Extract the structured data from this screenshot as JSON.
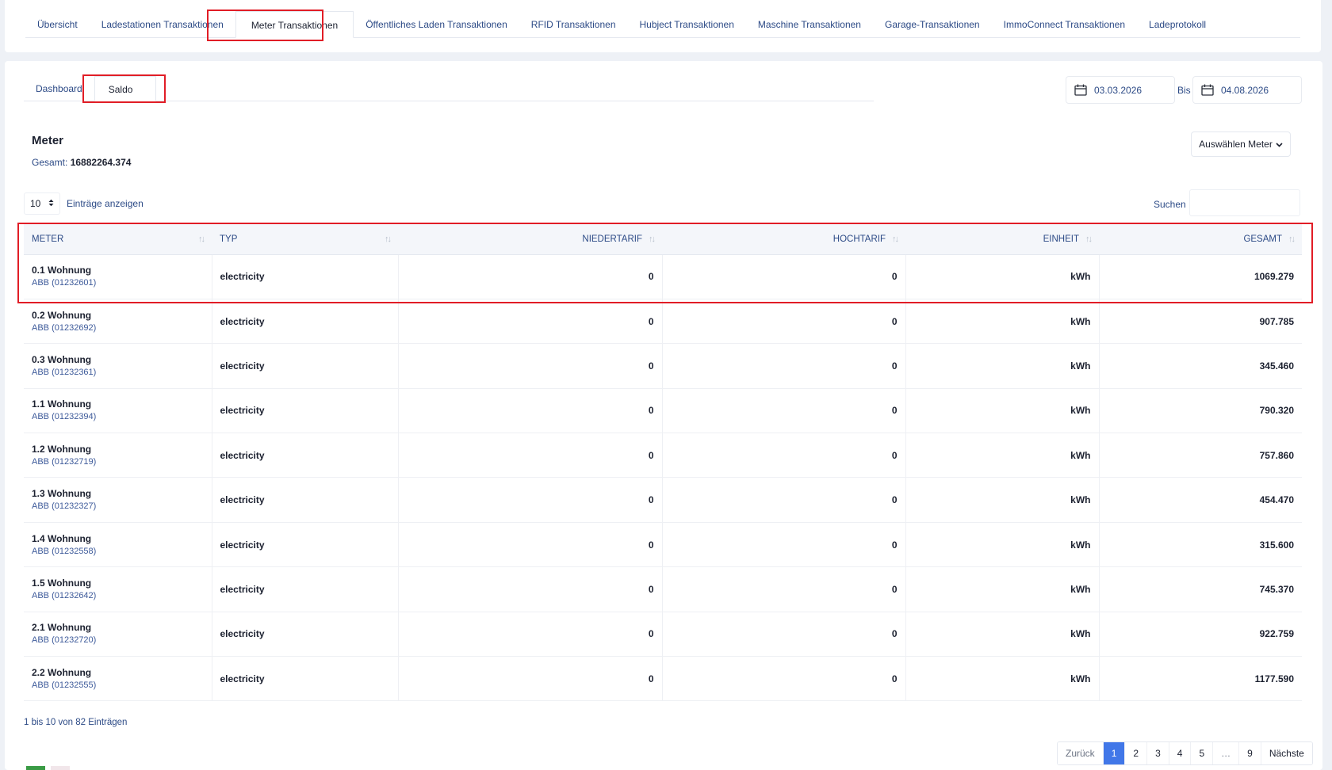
{
  "top_tabs": [
    {
      "label": "Übersicht"
    },
    {
      "label": "Ladestationen Transaktionen"
    },
    {
      "label": "Meter Transaktionen",
      "active": true
    },
    {
      "label": "Öffentliches Laden Transaktionen"
    },
    {
      "label": "RFID Transaktionen"
    },
    {
      "label": "Hubject Transaktionen"
    },
    {
      "label": "Maschine Transaktionen"
    },
    {
      "label": "Garage-Transaktionen"
    },
    {
      "label": "ImmoConnect Transaktionen"
    },
    {
      "label": "Ladeprotokoll"
    }
  ],
  "sub_tabs": [
    {
      "label": "Dashboard"
    },
    {
      "label": "Saldo",
      "active": true
    }
  ],
  "date_range": {
    "from": "03.03.2026",
    "separator": "Bis",
    "to": "04.08.2026"
  },
  "summary": {
    "title": "Meter",
    "total_label": "Gesamt:",
    "total_value": "16882264.374"
  },
  "meter_select": {
    "label": "Auswählen Meter"
  },
  "table_controls": {
    "page_size": "10",
    "page_size_label": "Einträge anzeigen",
    "search_label": "Suchen",
    "search_value": ""
  },
  "table": {
    "headers": [
      "METER",
      "TYP",
      "NIEDERTARIF",
      "HOCHTARIF",
      "EINHEIT",
      "GESAMT"
    ],
    "rows": [
      {
        "name": "0.1 Wohnung",
        "id": "ABB (01232601)",
        "typ": "electricity",
        "nieder": "0",
        "hoch": "0",
        "einheit": "kWh",
        "gesamt": "1069.279"
      },
      {
        "name": "0.2 Wohnung",
        "id": "ABB (01232692)",
        "typ": "electricity",
        "nieder": "0",
        "hoch": "0",
        "einheit": "kWh",
        "gesamt": "907.785"
      },
      {
        "name": "0.3 Wohnung",
        "id": "ABB (01232361)",
        "typ": "electricity",
        "nieder": "0",
        "hoch": "0",
        "einheit": "kWh",
        "gesamt": "345.460"
      },
      {
        "name": "1.1 Wohnung",
        "id": "ABB (01232394)",
        "typ": "electricity",
        "nieder": "0",
        "hoch": "0",
        "einheit": "kWh",
        "gesamt": "790.320"
      },
      {
        "name": "1.2 Wohnung",
        "id": "ABB (01232719)",
        "typ": "electricity",
        "nieder": "0",
        "hoch": "0",
        "einheit": "kWh",
        "gesamt": "757.860"
      },
      {
        "name": "1.3 Wohnung",
        "id": "ABB (01232327)",
        "typ": "electricity",
        "nieder": "0",
        "hoch": "0",
        "einheit": "kWh",
        "gesamt": "454.470"
      },
      {
        "name": "1.4 Wohnung",
        "id": "ABB (01232558)",
        "typ": "electricity",
        "nieder": "0",
        "hoch": "0",
        "einheit": "kWh",
        "gesamt": "315.600"
      },
      {
        "name": "1.5 Wohnung",
        "id": "ABB (01232642)",
        "typ": "electricity",
        "nieder": "0",
        "hoch": "0",
        "einheit": "kWh",
        "gesamt": "745.370"
      },
      {
        "name": "2.1 Wohnung",
        "id": "ABB (01232720)",
        "typ": "electricity",
        "nieder": "0",
        "hoch": "0",
        "einheit": "kWh",
        "gesamt": "922.759"
      },
      {
        "name": "2.2 Wohnung",
        "id": "ABB (01232555)",
        "typ": "electricity",
        "nieder": "0",
        "hoch": "0",
        "einheit": "kWh",
        "gesamt": "1177.590"
      }
    ]
  },
  "table_info": "1 bis 10 von 82 Einträgen",
  "pagination": {
    "prev": "Zurück",
    "pages": [
      "1",
      "2",
      "3",
      "4",
      "5",
      "…",
      "9"
    ],
    "next": "Nächste",
    "current": "1"
  },
  "colors": {
    "accent": "#4177e8",
    "link": "#2c4a86",
    "highlight": "#e11d26",
    "header_bg": "#f4f6fa"
  }
}
